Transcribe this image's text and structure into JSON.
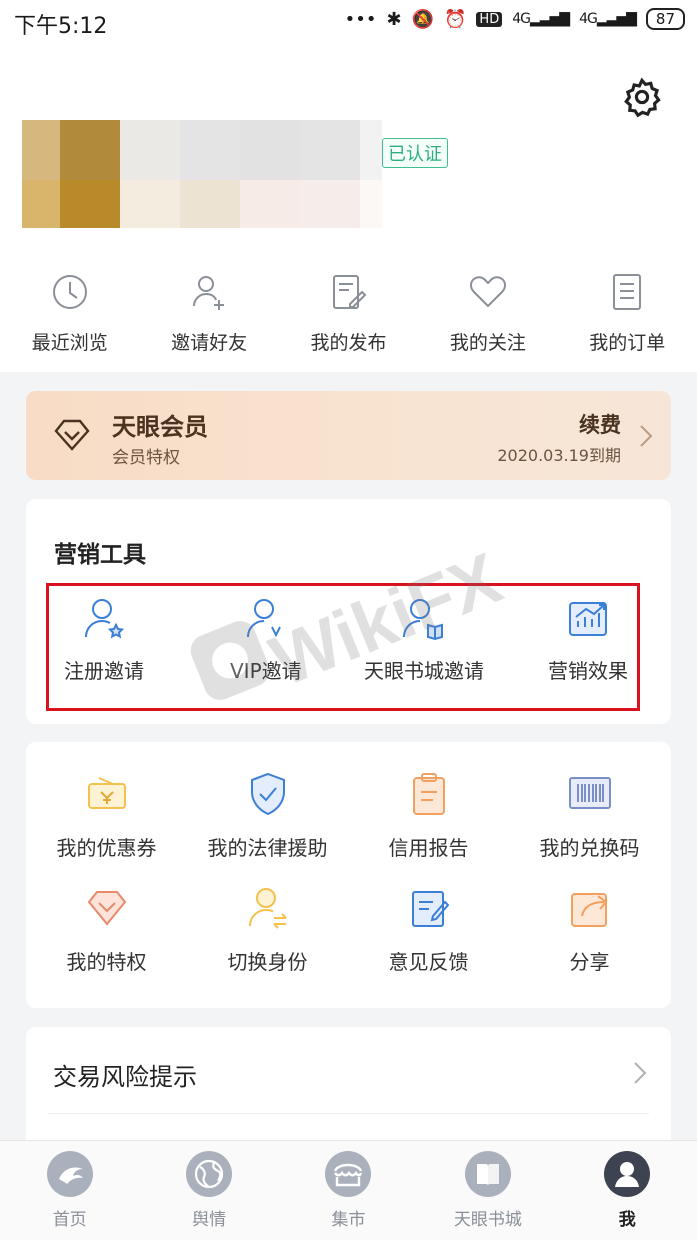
{
  "status_bar": {
    "time": "下午5:12",
    "dots": "•••",
    "hd": "HD",
    "net1": "4G",
    "net2": "4G",
    "battery": "87"
  },
  "profile": {
    "verified_badge": "已认证",
    "settings_icon": "gear-icon"
  },
  "quick_actions": [
    {
      "label": "最近浏览",
      "icon": "clock-icon"
    },
    {
      "label": "邀请好友",
      "icon": "add-user-icon"
    },
    {
      "label": "我的发布",
      "icon": "edit-doc-icon"
    },
    {
      "label": "我的关注",
      "icon": "heart-icon"
    },
    {
      "label": "我的订单",
      "icon": "order-doc-icon"
    }
  ],
  "membership": {
    "title": "天眼会员",
    "subtitle": "会员特权",
    "renew": "续费",
    "expire": "2020.03.19到期"
  },
  "marketing": {
    "title": "营销工具",
    "tools": [
      {
        "label": "注册邀请",
        "icon": "user-star-icon"
      },
      {
        "label": "VIP邀请",
        "icon": "user-vip-icon"
      },
      {
        "label": "天眼书城邀请",
        "icon": "user-book-icon"
      },
      {
        "label": "营销效果",
        "icon": "chart-growth-icon"
      }
    ]
  },
  "services": [
    {
      "label": "我的优惠券",
      "icon": "coupon-icon"
    },
    {
      "label": "我的法律援助",
      "icon": "shield-check-icon"
    },
    {
      "label": "信用报告",
      "icon": "clipboard-icon"
    },
    {
      "label": "我的兑换码",
      "icon": "barcode-icon"
    },
    {
      "label": "我的特权",
      "icon": "diamond-icon"
    },
    {
      "label": "切换身份",
      "icon": "switch-user-icon"
    },
    {
      "label": "意见反馈",
      "icon": "feedback-icon"
    },
    {
      "label": "分享",
      "icon": "share-icon"
    }
  ],
  "risk": {
    "label": "交易风险提示"
  },
  "watermark": "WikiFX",
  "tabs": [
    {
      "label": "首页",
      "icon": "eagle-icon",
      "active": false
    },
    {
      "label": "舆情",
      "icon": "globe-icon",
      "active": false
    },
    {
      "label": "集市",
      "icon": "market-icon",
      "active": false
    },
    {
      "label": "天眼书城",
      "icon": "book-icon",
      "active": false
    },
    {
      "label": "我",
      "icon": "user-icon",
      "active": true
    }
  ],
  "colors": {
    "accent_blue": "#3b7fd6",
    "accent_orange": "#f2a060",
    "accent_yellow": "#f2c14e",
    "verified_green": "#2eae7d",
    "highlight_red": "#d9121f"
  }
}
